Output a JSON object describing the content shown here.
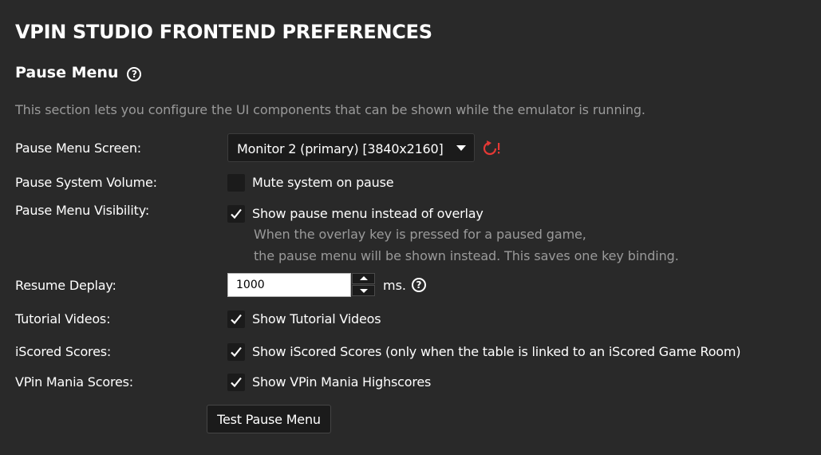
{
  "header": {
    "title": "VPIN STUDIO FRONTEND PREFERENCES"
  },
  "section": {
    "title": "Pause Menu",
    "description": "This section lets you configure the UI components that can be shown while the emulator is running."
  },
  "settings": {
    "screen": {
      "label": "Pause Menu Screen:",
      "selected": "Monitor 2 (primary) [3840x2160]"
    },
    "volume": {
      "label": "Pause System Volume:",
      "checkbox_label": "Mute system on pause",
      "checked": false
    },
    "visibility": {
      "label": "Pause Menu Visibility:",
      "checkbox_label": "Show pause menu instead of overlay",
      "checked": true,
      "hint_line1": "When the overlay key is pressed for a paused game,",
      "hint_line2": "the pause menu will be shown instead. This saves one key binding."
    },
    "resume_delay": {
      "label": "Resume Deplay:",
      "value": "1000",
      "unit": "ms."
    },
    "tutorial": {
      "label": "Tutorial Videos:",
      "checkbox_label": "Show Tutorial Videos",
      "checked": true
    },
    "iscored": {
      "label": "iScored Scores:",
      "checkbox_label": "Show iScored Scores (only when the table is linked to an iScored Game Room)",
      "checked": true
    },
    "vpinmania": {
      "label": "VPin Mania Scores:",
      "checkbox_label": "Show VPin Mania Highscores",
      "checked": true
    }
  },
  "actions": {
    "test_label": "Test Pause Menu"
  },
  "icons": {
    "help": "help-circle-icon",
    "reset": "reset-icon",
    "dropdown": "chevron-down-icon",
    "check": "check-icon"
  },
  "colors": {
    "background": "#292929",
    "reset_accent": "#e53935",
    "muted_text": "#9a9a9a"
  }
}
